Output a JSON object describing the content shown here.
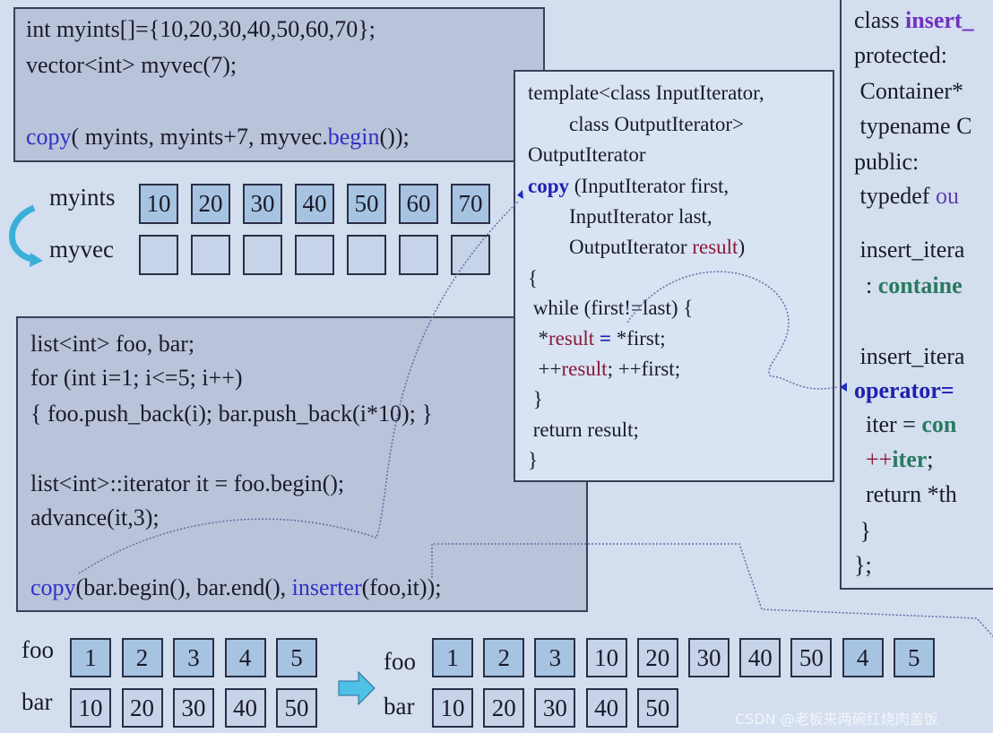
{
  "box1": [
    [
      {
        "t": "int myints[]={10,20,30,40,50,60,70};"
      }
    ],
    [
      {
        "t": "vector<int> myvec(7);"
      }
    ],
    [
      {
        "t": "copy",
        "c": "c-blue"
      },
      {
        "t": "( myints, myints+7, myvec."
      },
      {
        "t": "begin",
        "c": "c-blue"
      },
      {
        "t": "());"
      }
    ]
  ],
  "arrays1": {
    "myints_label": "myints",
    "myvec_label": "myvec",
    "myints": [
      "10",
      "20",
      "30",
      "40",
      "50",
      "60",
      "70"
    ],
    "myvec": [
      "",
      "",
      "",
      "",
      "",
      "",
      ""
    ]
  },
  "box2": [
    [
      {
        "t": "list<int> foo, bar;"
      }
    ],
    [
      {
        "t": "for (int i=1; i<=5; i++)"
      }
    ],
    [
      {
        "t": "{ foo.push_back(i); bar.push_back(i*10); }"
      }
    ],
    [
      {
        "t": "list<int>::iterator it = foo.begin();"
      }
    ],
    [
      {
        "t": "advance(it,3);"
      }
    ],
    [
      {
        "t": "copy",
        "c": "c-blue"
      },
      {
        "t": "(bar.begin(), bar.end(), "
      },
      {
        "t": "inserter",
        "c": "c-blue"
      },
      {
        "t": "(foo,it));"
      }
    ]
  ],
  "template_box": [
    [
      {
        "t": "template<class InputIterator,"
      }
    ],
    [
      {
        "t": "        class OutputIterator>"
      }
    ],
    [
      {
        "t": "OutputIterator"
      }
    ],
    [
      {
        "t": "copy",
        "c": "c-bblue"
      },
      {
        "t": " (InputIterator first,"
      }
    ],
    [
      {
        "t": "        InputIterator last,"
      }
    ],
    [
      {
        "t": "        OutputIterator "
      },
      {
        "t": "result",
        "c": "c-red"
      },
      {
        "t": ")"
      }
    ],
    [
      {
        "t": "{"
      }
    ],
    [
      {
        "t": " while (first!=last) {"
      }
    ],
    [
      {
        "t": "  *"
      },
      {
        "t": "result",
        "c": "c-red"
      },
      {
        "t": " "
      },
      {
        "t": "=",
        "c": "c-bblue"
      },
      {
        "t": " *first;"
      }
    ],
    [
      {
        "t": "  ++"
      },
      {
        "t": "result",
        "c": "c-red"
      },
      {
        "t": "; ++first;"
      }
    ],
    [
      {
        "t": " }"
      }
    ],
    [
      {
        "t": " return result;"
      }
    ],
    [
      {
        "t": "}"
      }
    ]
  ],
  "right_box": [
    [
      {
        "t": "class "
      },
      {
        "t": "insert_",
        "c": "c-purple"
      }
    ],
    [
      {
        "t": "protected:"
      }
    ],
    [
      {
        "t": " Container*"
      }
    ],
    [
      {
        "t": " typename C"
      }
    ],
    [
      {
        "t": "public:"
      }
    ],
    [
      {
        "t": " typedef "
      },
      {
        "t": "ou",
        "c": "c-violet"
      }
    ],
    [
      {
        "t": " insert_itera"
      }
    ],
    [
      {
        "t": "  : "
      },
      {
        "t": "containe",
        "c": "c-green"
      }
    ],
    [
      {
        "t": " insert_itera"
      }
    ],
    [
      {
        "t": "operator=",
        "c": "c-bblue"
      }
    ],
    [
      {
        "t": "  iter = "
      },
      {
        "t": "con",
        "c": "c-green"
      }
    ],
    [
      {
        "t": "  ++",
        "c": "c-red"
      },
      {
        "t": "iter",
        "c": "c-green"
      },
      {
        "t": ";"
      }
    ],
    [
      {
        "t": "  return *th"
      }
    ],
    [
      {
        "t": " }"
      }
    ],
    [
      {
        "t": "};"
      }
    ]
  ],
  "arrays2": {
    "foo_label": "foo",
    "bar_label": "bar",
    "foo": [
      "1",
      "2",
      "3",
      "4",
      "5"
    ],
    "bar": [
      "10",
      "20",
      "30",
      "40",
      "50"
    ]
  },
  "arrays3": {
    "foo_label": "foo",
    "bar_label": "bar",
    "foo": [
      "1",
      "2",
      "3",
      "10",
      "20",
      "30",
      "40",
      "50",
      "4",
      "5"
    ],
    "bar": [
      "10",
      "20",
      "30",
      "40",
      "50"
    ]
  },
  "watermark": "CSDN @老板来两碗红烧肉盖饭",
  "colors": {
    "background": "#d3deef",
    "code_box": "#b9c3d9",
    "template_box": "#d8e3f3",
    "cell_filled": "#a7c3e2",
    "cell_empty": "#c6d3e8",
    "arrow": "#3ab0d8"
  }
}
